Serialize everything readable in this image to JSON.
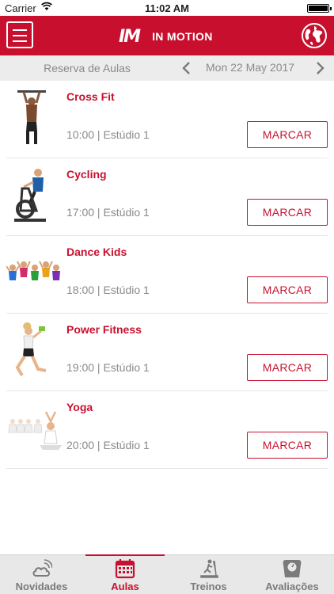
{
  "status_bar": {
    "carrier": "Carrier",
    "time": "11:02 AM"
  },
  "nav": {
    "logo_text": "IM",
    "title": "IN MOTION",
    "menu_icon": "hamburger-menu-icon",
    "globe_icon": "globe-icon"
  },
  "date_bar": {
    "section_title": "Reserva de Aulas",
    "date": "Mon 22 May 2017"
  },
  "classes": [
    {
      "name": "Cross Fit",
      "time": "10:00 | Estúdio 1",
      "button": "MARCAR",
      "image": "pull-up-athlete"
    },
    {
      "name": "Cycling",
      "time": "17:00 | Estúdio 1",
      "button": "MARCAR",
      "image": "spin-bike-rider"
    },
    {
      "name": "Dance Kids",
      "time": "18:00 | Estúdio 1",
      "button": "MARCAR",
      "image": "jumping-kids"
    },
    {
      "name": "Power Fitness",
      "time": "19:00 | Estúdio 1",
      "button": "MARCAR",
      "image": "dumbbell-woman"
    },
    {
      "name": "Yoga",
      "time": "20:00 | Estúdio 1",
      "button": "MARCAR",
      "image": "yoga-group"
    }
  ],
  "tabs": [
    {
      "label": "Novidades",
      "icon": "cloud-signal-icon",
      "active": false
    },
    {
      "label": "Aulas",
      "icon": "calendar-icon",
      "active": true
    },
    {
      "label": "Treinos",
      "icon": "treadmill-icon",
      "active": false
    },
    {
      "label": "Avaliações",
      "icon": "scale-icon",
      "active": false
    }
  ],
  "colors": {
    "brand": "#c8102e",
    "date_bar_bg": "#ececec",
    "tab_bar_bg": "#e8e8e8",
    "muted_text": "#8a8a8a"
  }
}
